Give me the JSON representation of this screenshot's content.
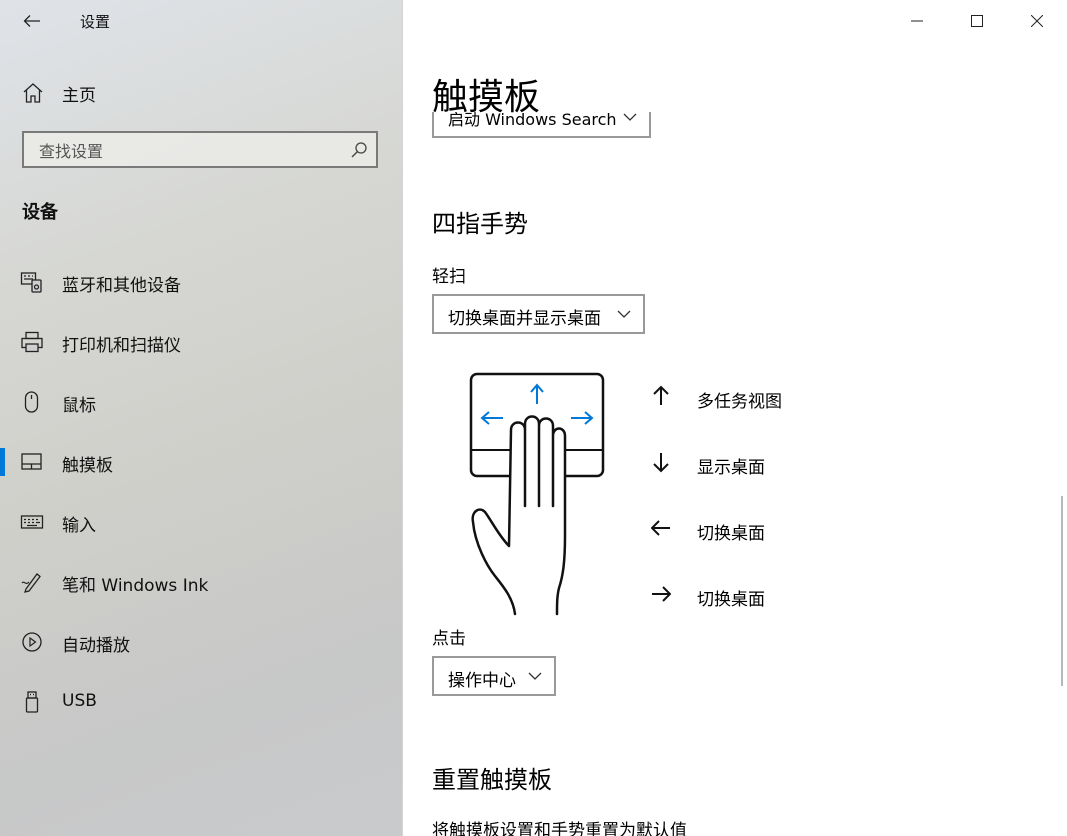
{
  "window": {
    "app_title": "设置",
    "controls": {
      "minimize": "minimize-icon",
      "maximize": "maximize-icon",
      "close": "close-icon"
    }
  },
  "sidebar": {
    "home_label": "主页",
    "search_placeholder": "查找设置",
    "section_title": "设备",
    "items": [
      {
        "label": "蓝牙和其他设备",
        "icon": "bluetooth-devices-icon"
      },
      {
        "label": "打印机和扫描仪",
        "icon": "printer-icon"
      },
      {
        "label": "鼠标",
        "icon": "mouse-icon"
      },
      {
        "label": "触摸板",
        "icon": "touchpad-icon",
        "active": true
      },
      {
        "label": "输入",
        "icon": "keyboard-icon"
      },
      {
        "label": "笔和 Windows Ink",
        "icon": "pen-icon"
      },
      {
        "label": "自动播放",
        "icon": "autoplay-icon"
      },
      {
        "label": "USB",
        "icon": "usb-icon"
      }
    ],
    "accent": "#0078d7"
  },
  "main": {
    "page_title": "触摸板",
    "partial_dropdown_value": "启动 Windows Search",
    "four_finger": {
      "title": "四指手势",
      "swipe_label": "轻扫",
      "swipe_value": "切换桌面并显示桌面",
      "gestures": [
        {
          "direction": "up",
          "icon": "arrow-up-icon",
          "label": "多任务视图"
        },
        {
          "direction": "down",
          "icon": "arrow-down-icon",
          "label": "显示桌面"
        },
        {
          "direction": "left",
          "icon": "arrow-left-icon",
          "label": "切换桌面"
        },
        {
          "direction": "right",
          "icon": "arrow-right-icon",
          "label": "切换桌面"
        }
      ],
      "tap_label": "点击",
      "tap_value": "操作中心"
    },
    "reset": {
      "title": "重置触摸板",
      "description": "将触摸板设置和手势重置为默认值"
    }
  }
}
